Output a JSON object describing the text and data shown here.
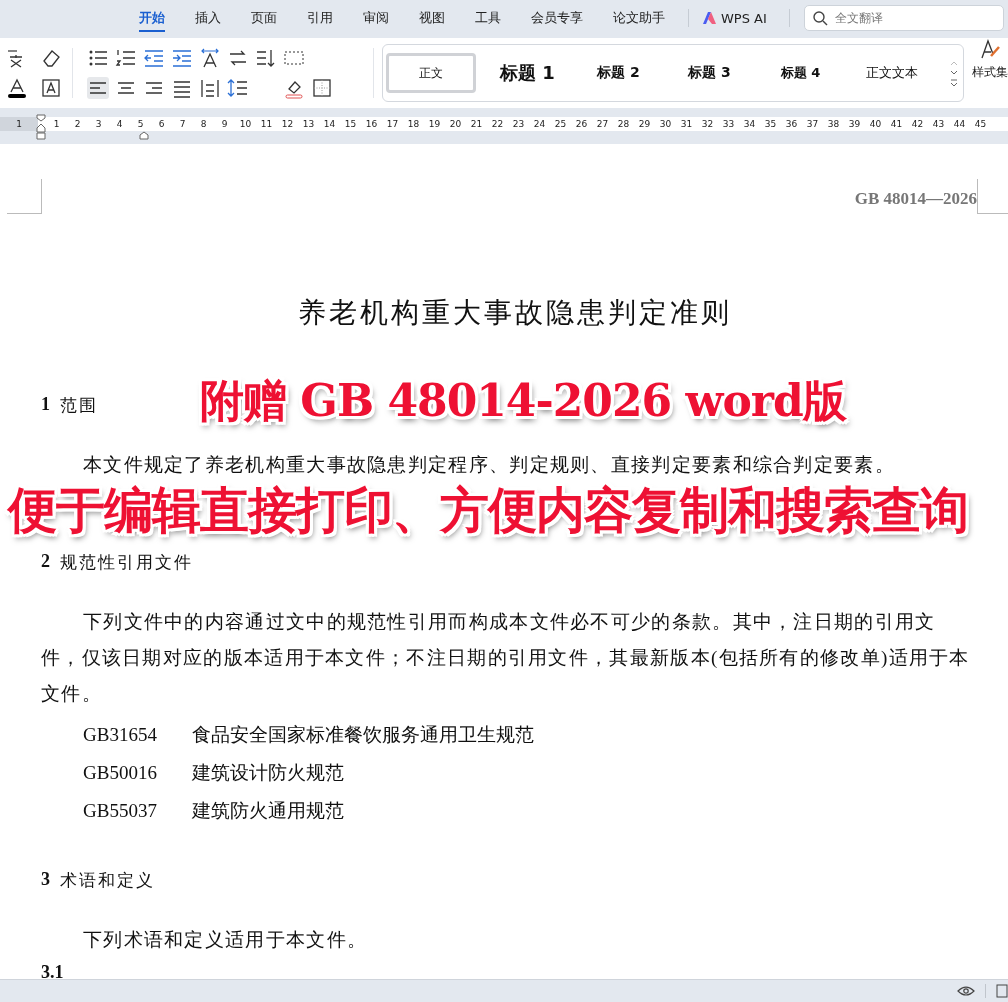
{
  "menu_tabs": [
    {
      "label": "开始",
      "selected": true
    },
    {
      "label": "插入",
      "selected": false
    },
    {
      "label": "页面",
      "selected": false
    },
    {
      "label": "引用",
      "selected": false
    },
    {
      "label": "审阅",
      "selected": false
    },
    {
      "label": "视图",
      "selected": false
    },
    {
      "label": "工具",
      "selected": false
    },
    {
      "label": "会员专享",
      "selected": false
    },
    {
      "label": "论文助手",
      "selected": false
    }
  ],
  "ai_tab": {
    "label": "WPS AI"
  },
  "search": {
    "placeholder": "全文翻译"
  },
  "styles": [
    {
      "label": "正文",
      "kind": "body",
      "selected": true
    },
    {
      "label": "标题 1",
      "kind": "h1",
      "selected": false
    },
    {
      "label": "标题 2",
      "kind": "h2",
      "selected": false
    },
    {
      "label": "标题 3",
      "kind": "h3",
      "selected": false
    },
    {
      "label": "标题 4",
      "kind": "h4",
      "selected": false
    },
    {
      "label": "正文文本",
      "kind": "text",
      "selected": false
    }
  ],
  "style_set": {
    "label": "样式集"
  },
  "ruler": {
    "marks": [
      "1",
      "1",
      "2",
      "3",
      "4",
      "5",
      "6",
      "7",
      "8",
      "9",
      "10",
      "11",
      "12",
      "13",
      "14",
      "15",
      "16",
      "17",
      "18",
      "19",
      "20",
      "21",
      "22",
      "23",
      "24",
      "25",
      "26",
      "27",
      "28",
      "29",
      "30",
      "31",
      "32",
      "33",
      "34",
      "35",
      "36",
      "37",
      "38",
      "39",
      "40",
      "41",
      "42",
      "43",
      "44",
      "45"
    ]
  },
  "document": {
    "header_code": "GB 48014—2026",
    "title": "养老机构重大事故隐患判定准则",
    "blocks": [
      {
        "kind": "heading",
        "number": "1",
        "text": "范围"
      },
      {
        "kind": "paragraph",
        "text": "本文件规定了养老机构重大事故隐患判定程序、判定规则、直接判定要素和综合判定要素。"
      },
      {
        "kind": "heading",
        "number": "2",
        "text": "规范性引用文件"
      },
      {
        "kind": "paragraph",
        "text": "下列文件中的内容通过文中的规范性引用而构成本文件必不可少的条款。其中，注日期的引用文件，仅该日期对应的版本适用于本文件；不注日期的引用文件，其最新版本(包括所有的修改单)适用于本文件。"
      },
      {
        "kind": "reference",
        "code": "GB31654",
        "text": "食品安全国家标准餐饮服务通用卫生规范"
      },
      {
        "kind": "reference",
        "code": "GB50016",
        "text": "建筑设计防火规范"
      },
      {
        "kind": "reference",
        "code": "GB55037",
        "text": "建筑防火通用规范"
      },
      {
        "kind": "heading",
        "number": "3",
        "text": "术语和定义"
      },
      {
        "kind": "paragraph",
        "text": "下列术语和定义适用于本文件。"
      },
      {
        "kind": "subheading",
        "number": "3.1"
      }
    ]
  },
  "overlay": {
    "lines": [
      "附赠 GB 48014-2026 word版",
      "便于编辑直接打印、方便内容复制和搜索查询"
    ]
  }
}
